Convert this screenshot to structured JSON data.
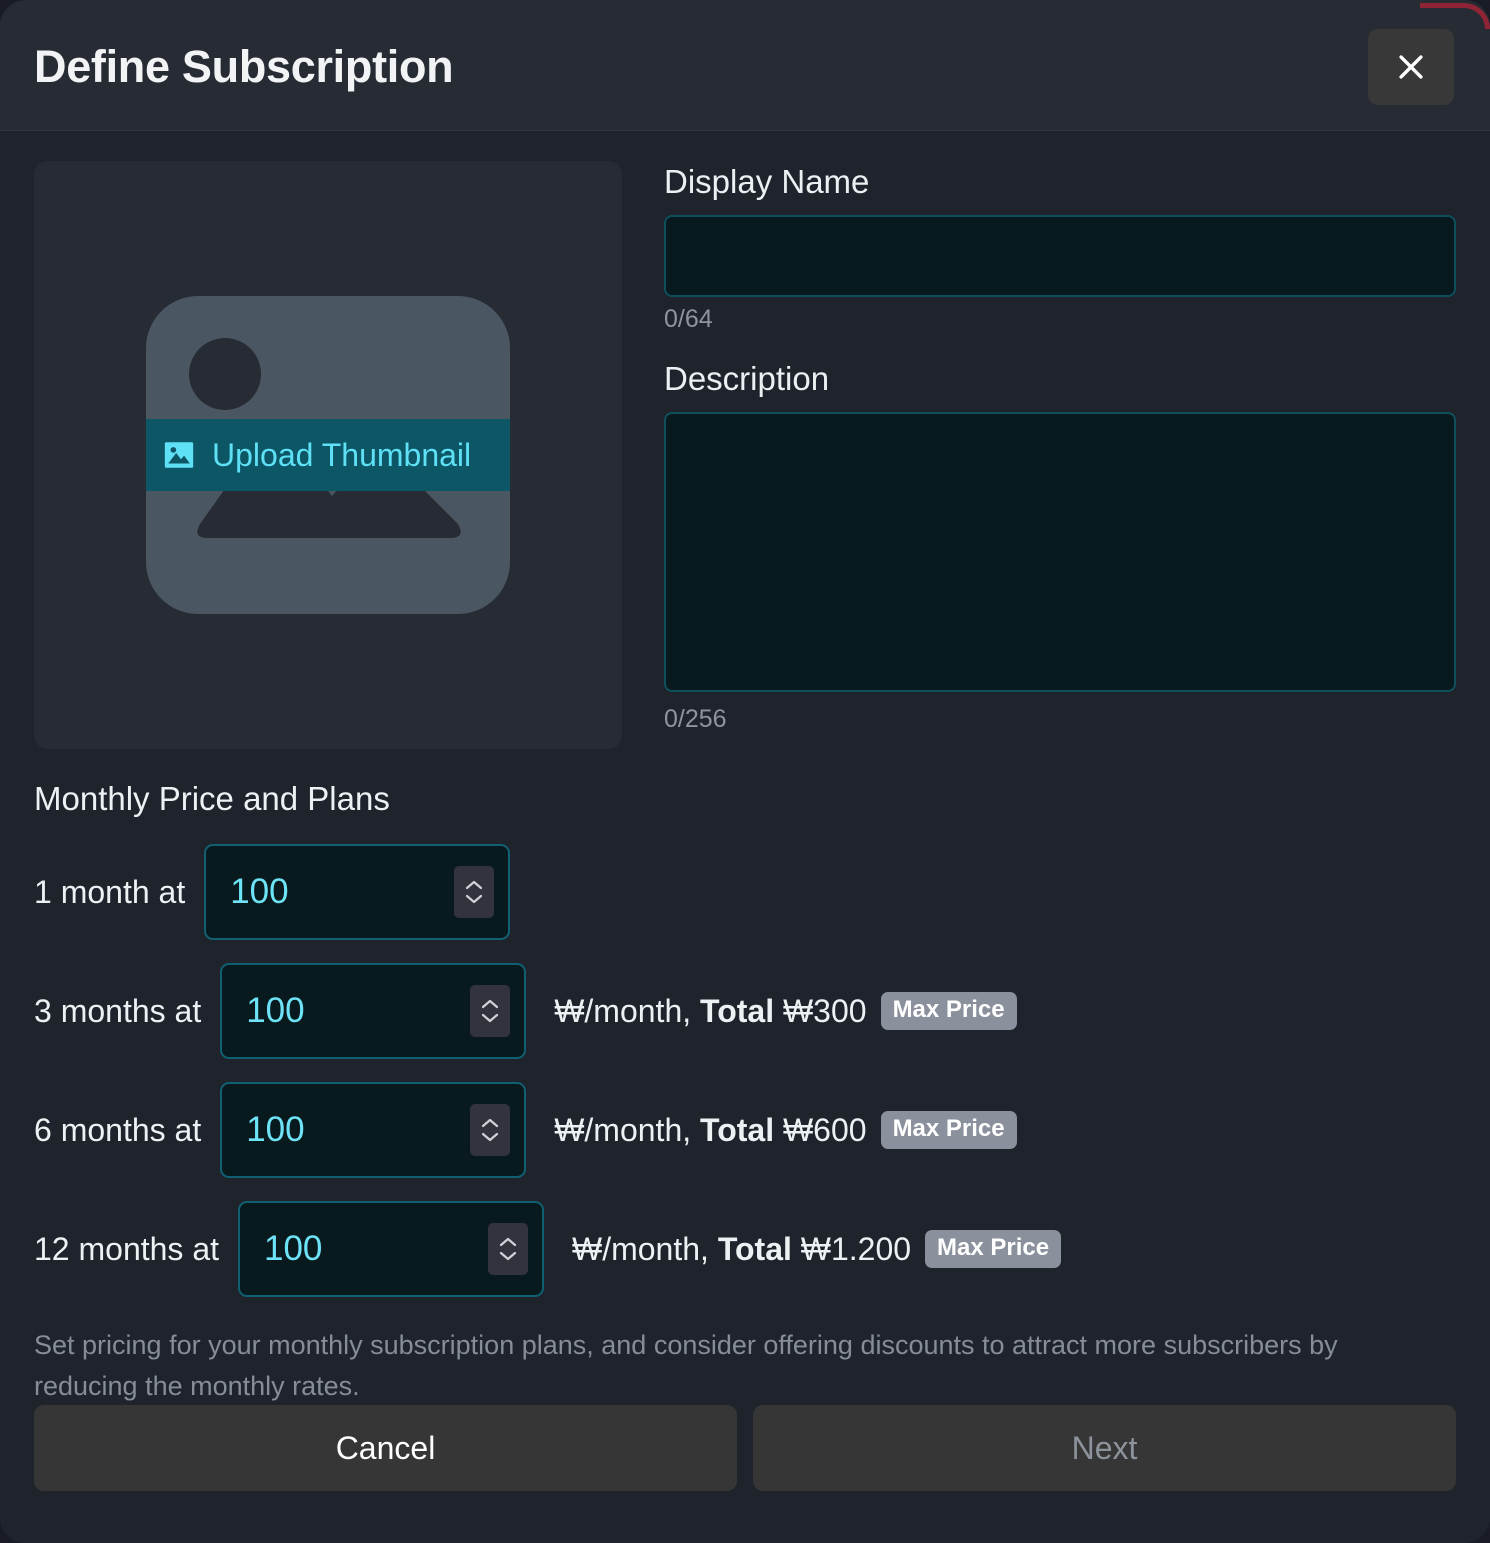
{
  "modal": {
    "title": "Define Subscription",
    "close_label": "×",
    "accent_color": "#8f2436"
  },
  "thumbnail": {
    "upload_label": "Upload Thumbnail",
    "icon": "image-icon",
    "chip_color": "#0d5666",
    "chip_text_color": "#5ee0f5"
  },
  "display_name": {
    "label": "Display Name",
    "value": "",
    "placeholder": "",
    "counter": "0/64"
  },
  "description": {
    "label": "Description",
    "value": "",
    "placeholder": "",
    "counter": "0/256"
  },
  "pricing": {
    "section_title": "Monthly Price and Plans",
    "currency_symbol": "₩",
    "badge_label": "Max Price",
    "rows": [
      {
        "label": "1 month at",
        "value": "100",
        "suffix_unit": "",
        "total_label": "",
        "total_value": "",
        "has_badge": false
      },
      {
        "label": "3 months at",
        "value": "100",
        "suffix_unit": "₩/month,",
        "total_label": "Total",
        "total_value": "₩300",
        "has_badge": true
      },
      {
        "label": "6 months at",
        "value": "100",
        "suffix_unit": "₩/month,",
        "total_label": "Total",
        "total_value": "₩600",
        "has_badge": true
      },
      {
        "label": "12 months at",
        "value": "100",
        "suffix_unit": "₩/month,",
        "total_label": "Total",
        "total_value": "₩1.200",
        "has_badge": true
      }
    ],
    "help_text": "Set pricing for your monthly subscription plans, and consider offering discounts to attract more subscribers by reducing the monthly rates."
  },
  "footer": {
    "cancel_label": "Cancel",
    "next_label": "Next",
    "next_disabled": true
  }
}
